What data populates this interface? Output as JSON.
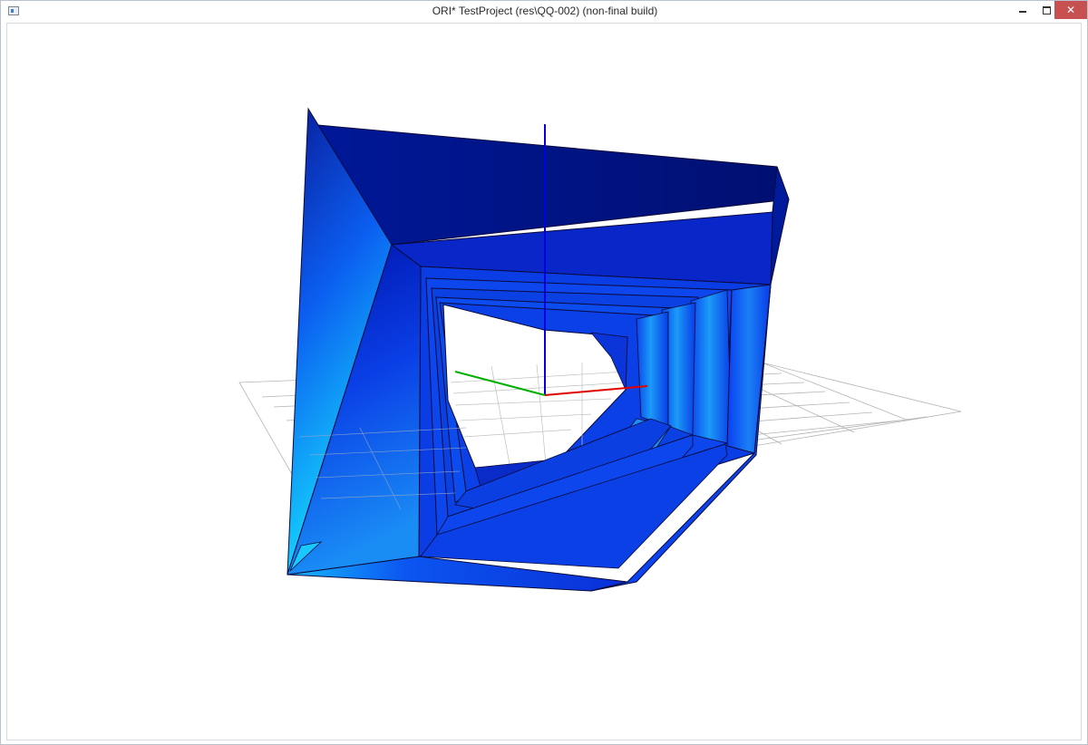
{
  "window": {
    "title": "ORI* TestProject (res\\QQ-002) (non-final build)",
    "icon": "app-icon",
    "controls": {
      "minimize": "minimize-icon",
      "maximize": "maximize-icon",
      "close": "close-icon",
      "close_glyph": "✕"
    },
    "colors": {
      "close_button": "#c75050",
      "border": "#b9c3cf"
    }
  },
  "scene": {
    "axes": {
      "x_color": "#e00000",
      "y_color": "#00b000",
      "z_color": "#0000e0"
    },
    "grid_color": "#b4b4b4",
    "mesh_colors": {
      "deep": "#00127a",
      "mid": "#0a3cf0",
      "light": "#1aa0f5",
      "cyan": "#19e6ff"
    }
  }
}
